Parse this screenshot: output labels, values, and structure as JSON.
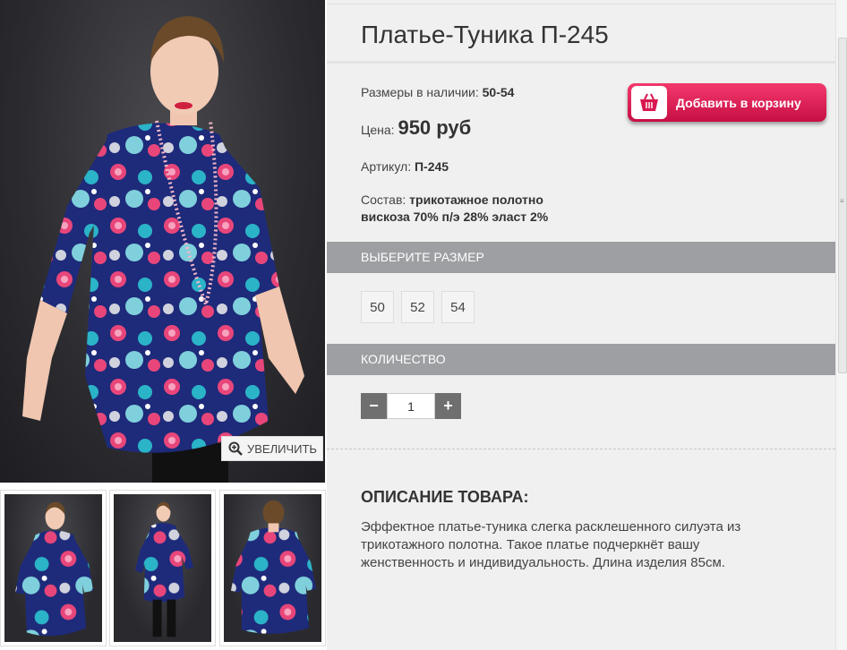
{
  "product": {
    "title": "Платье-Туника П-245",
    "sizes_label": "Размеры в наличии: ",
    "sizes_value": "50-54",
    "price_label": "Цена: ",
    "price_value": "950 руб",
    "sku_label": "Артикул: ",
    "sku_value": "П-245",
    "composition_label": "Состав: ",
    "composition_line1": "трикотажное полотно",
    "composition_line2": "вискоза 70% п/э 28% эласт 2%"
  },
  "cart": {
    "label": "Добавить в корзину",
    "icon": "basket-icon",
    "color": "#e0245a"
  },
  "zoom": {
    "label": "УВЕЛИЧИТЬ",
    "icon": "zoom-in-icon"
  },
  "size_section": {
    "header": "ВЫБЕРИТЕ РАЗМЕР",
    "options": [
      "50",
      "52",
      "54"
    ]
  },
  "quantity_section": {
    "header": "КОЛИЧЕСТВО",
    "minus": "−",
    "plus": "+",
    "value": "1"
  },
  "description": {
    "title": "ОПИСАНИЕ ТОВАРА:",
    "text": "Эффектное платье-туника слегка расклешенного силуэта из трикотажного полотна. Такое платье подчеркнёт вашу женственность и индивидуальность. Длина изделия 85см."
  },
  "colors": {
    "section_bar": "#9d9fa2",
    "panel_bg": "#f0f0f0",
    "dress_base": "#1e2a7a"
  }
}
